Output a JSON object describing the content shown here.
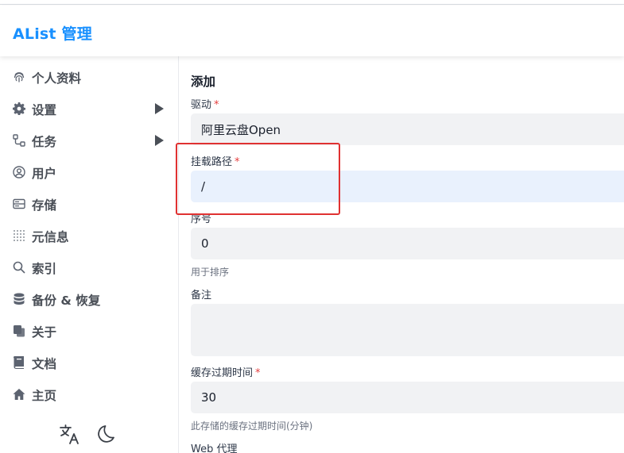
{
  "app": {
    "title": "AList 管理"
  },
  "sidebar": {
    "items": [
      {
        "label": "个人资料",
        "icon": "fingerprint-icon"
      },
      {
        "label": "设置",
        "icon": "gear-icon",
        "expandable": true
      },
      {
        "label": "任务",
        "icon": "flow-icon",
        "expandable": true
      },
      {
        "label": "用户",
        "icon": "user-circle-icon"
      },
      {
        "label": "存储",
        "icon": "storage-icon"
      },
      {
        "label": "元信息",
        "icon": "dots-grid-icon"
      },
      {
        "label": "索引",
        "icon": "search-icon"
      },
      {
        "label": "备份 & 恢复",
        "icon": "database-icon"
      },
      {
        "label": "关于",
        "icon": "copy-icon"
      },
      {
        "label": "文档",
        "icon": "book-icon"
      },
      {
        "label": "主页",
        "icon": "home-icon"
      }
    ],
    "footer": {
      "language_icon": "translate-icon",
      "theme_icon": "moon-icon"
    }
  },
  "form": {
    "heading": "添加",
    "driver": {
      "label": "驱动",
      "required_mark": "*",
      "value": "阿里云盘Open"
    },
    "mount_path": {
      "label": "挂载路径",
      "required_mark": "*",
      "value": "/"
    },
    "order": {
      "label": "序号",
      "value": "0",
      "helper": "用于排序"
    },
    "remark": {
      "label": "备注",
      "value": ""
    },
    "cache_expiration": {
      "label": "缓存过期时间",
      "required_mark": "*",
      "value": "30",
      "helper": "此存储的缓存过期时间(分钟)"
    },
    "web_proxy": {
      "label": "Web 代理"
    }
  },
  "colors": {
    "brand": "#1890ff",
    "required": "#e53e3e",
    "highlight": "#e03131"
  }
}
